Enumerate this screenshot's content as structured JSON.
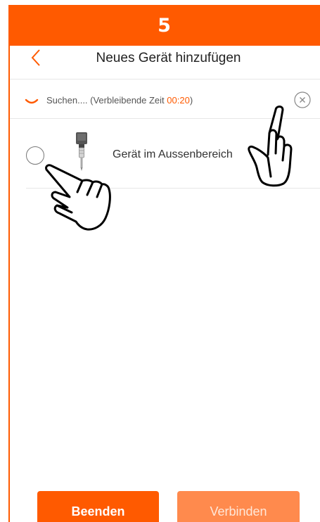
{
  "step": {
    "number": "5"
  },
  "header": {
    "title": "Neues Gerät hinzufügen"
  },
  "search": {
    "label": "Suchen.... (Verbleibende Zeit ",
    "time": "00:20",
    "suffix": ")"
  },
  "devices": [
    {
      "name": "Gerät im Aussenbereich",
      "selected": false
    }
  ],
  "buttons": {
    "finish": "Beenden",
    "connect": "Verbinden"
  },
  "colors": {
    "accent": "#ff5a00",
    "accent_disabled": "#ff8a4d"
  },
  "icons": {
    "back": "chevron-left-icon",
    "spinner": "loading-spinner-icon",
    "close": "close-circle-icon",
    "device": "outdoor-sensor-icon",
    "hand_cursor": "pointing-hand-icon"
  }
}
